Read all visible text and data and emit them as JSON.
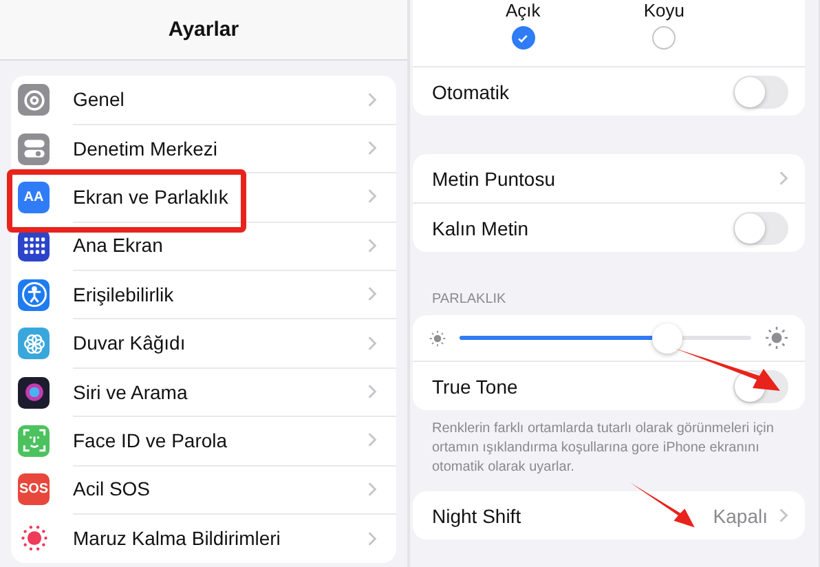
{
  "sidebar": {
    "title": "Ayarlar",
    "items": [
      {
        "label": "Genel",
        "kind": "gear",
        "color": "#8e8e93",
        "highlighted": false
      },
      {
        "label": "Denetim Merkezi",
        "kind": "switches",
        "color": "#8e8e93",
        "highlighted": false
      },
      {
        "label": "Ekran ve Parlaklık",
        "kind": "text",
        "icon_text": "AA",
        "color": "#2f7cf6",
        "highlighted": true
      },
      {
        "label": "Ana Ekran",
        "kind": "grid",
        "color": "#2c44c9",
        "highlighted": false
      },
      {
        "label": "Erişilebilirlik",
        "kind": "person",
        "color": "#1f7cf0",
        "highlighted": false
      },
      {
        "label": "Duvar Kâğıdı",
        "kind": "flower",
        "color": "#3aa7dc",
        "highlighted": false
      },
      {
        "label": "Siri ve Arama",
        "kind": "orb",
        "color": "#1c1c2e",
        "highlighted": false
      },
      {
        "label": "Face ID ve Parola",
        "kind": "face",
        "color": "#4cc25f",
        "highlighted": false
      },
      {
        "label": "Acil SOS",
        "kind": "text",
        "icon_text": "SOS",
        "color": "#e8473b",
        "highlighted": false
      },
      {
        "label": "Maruz Kalma Bildirimleri",
        "kind": "virus",
        "color": "#ef3a5a",
        "highlighted": false
      }
    ]
  },
  "detail": {
    "appearance": [
      {
        "label": "Açık",
        "selected": true
      },
      {
        "label": "Koyu",
        "selected": false
      }
    ],
    "automatic": {
      "label": "Otomatik",
      "on": false
    },
    "text_group": [
      {
        "kind": "link",
        "label": "Metin Puntosu"
      },
      {
        "kind": "toggle",
        "label": "Kalın Metin",
        "on": false
      }
    ],
    "brightness": {
      "header": "PARLAKLIK",
      "level": 0.71,
      "true_tone": {
        "label": "True Tone",
        "on": false
      },
      "footer": "Renklerin farklı ortamlarda tutarlı olarak görünmeleri için ortamın ışıklandırma koşullarına gore iPhone ekranını otomatik olarak uyarlar."
    },
    "night_shift": {
      "label": "Night Shift",
      "value": "Kapalı"
    }
  }
}
